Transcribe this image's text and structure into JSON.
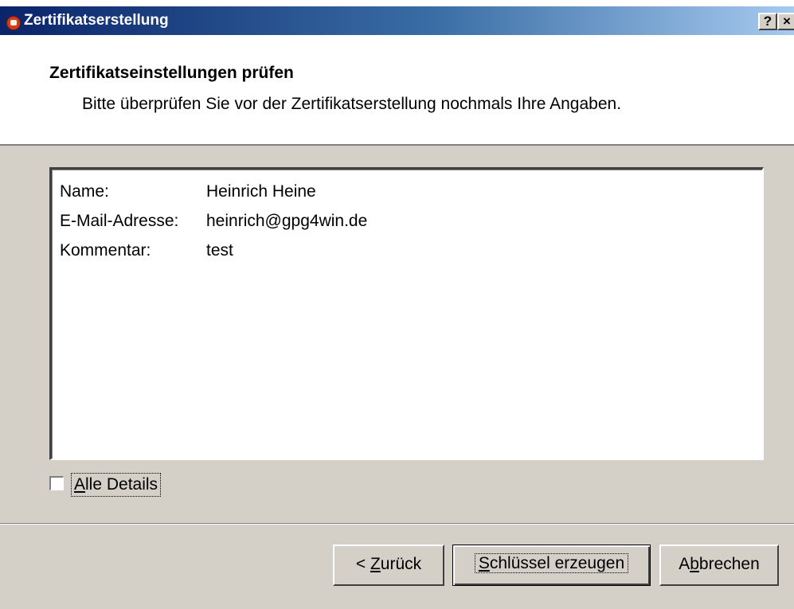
{
  "window": {
    "title": "Zertifikatserstellung",
    "help_label": "?",
    "close_label": "×"
  },
  "header": {
    "title": "Zertifikatseinstellungen prüfen",
    "subtitle": "Bitte überprüfen Sie vor der Zertifikatserstellung nochmals Ihre Angaben."
  },
  "summary": {
    "rows": [
      {
        "label": "Name:",
        "value": "Heinrich Heine"
      },
      {
        "label": "E-Mail-Adresse:",
        "value": "heinrich@gpg4win.de"
      },
      {
        "label": "Kommentar:",
        "value": "test"
      }
    ]
  },
  "details_checkbox": {
    "label_mnemonic": "A",
    "label_rest": "lle Details",
    "checked": false
  },
  "buttons": {
    "back_prefix": "< ",
    "back_mnemonic": "Z",
    "back_rest": "urück",
    "create_mnemonic": "S",
    "create_rest": "chlüssel erzeugen",
    "cancel_prefix": "A",
    "cancel_mnemonic": "b",
    "cancel_rest": "brechen"
  }
}
